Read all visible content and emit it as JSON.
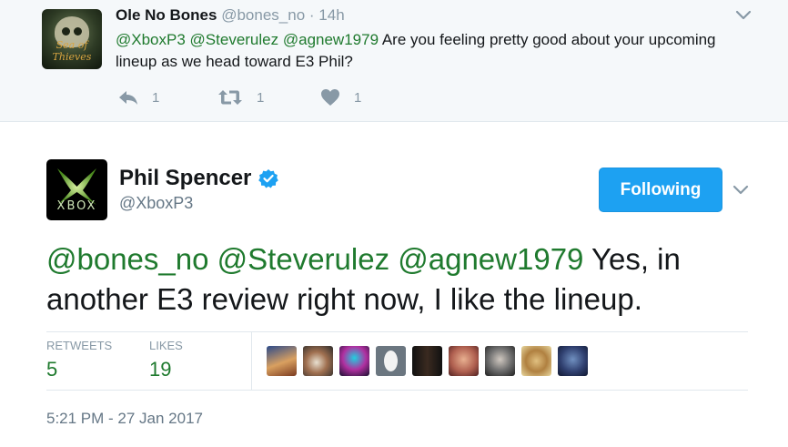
{
  "reply": {
    "name": "Ole No Bones",
    "handle": "@bones_no",
    "separator": "·",
    "time": "14h",
    "mentions": [
      "@XboxP3",
      "@Steverulez",
      "@agnew1979"
    ],
    "text": "Are you feeling pretty good about your upcoming lineup as we head toward E3 Phil?",
    "avatar_logo_text": "Sea of Thieves",
    "reply_count": "1",
    "retweet_count": "1",
    "like_count": "1"
  },
  "tweet": {
    "name": "Phil Spencer",
    "handle": "@XboxP3",
    "avatar_text": "XBOX",
    "follow_label": "Following",
    "mentions": [
      "@bones_no",
      "@Steverulez",
      "@agnew1979"
    ],
    "text": "Yes, in another E3 review right now, I like the lineup.",
    "stats": {
      "retweets_label": "RETWEETS",
      "retweets_value": "5",
      "likes_label": "LIKES",
      "likes_value": "19"
    },
    "timestamp": "5:21 PM - 27 Jan 2017"
  },
  "colors": {
    "mention": "#1f7a2e",
    "follow_button": "#1da1f2",
    "muted": "#8899a6",
    "verified": "#1da1f2"
  },
  "icons": [
    "reply-icon",
    "retweet-icon",
    "heart-icon",
    "chevron-down-icon",
    "verified-badge-icon"
  ]
}
